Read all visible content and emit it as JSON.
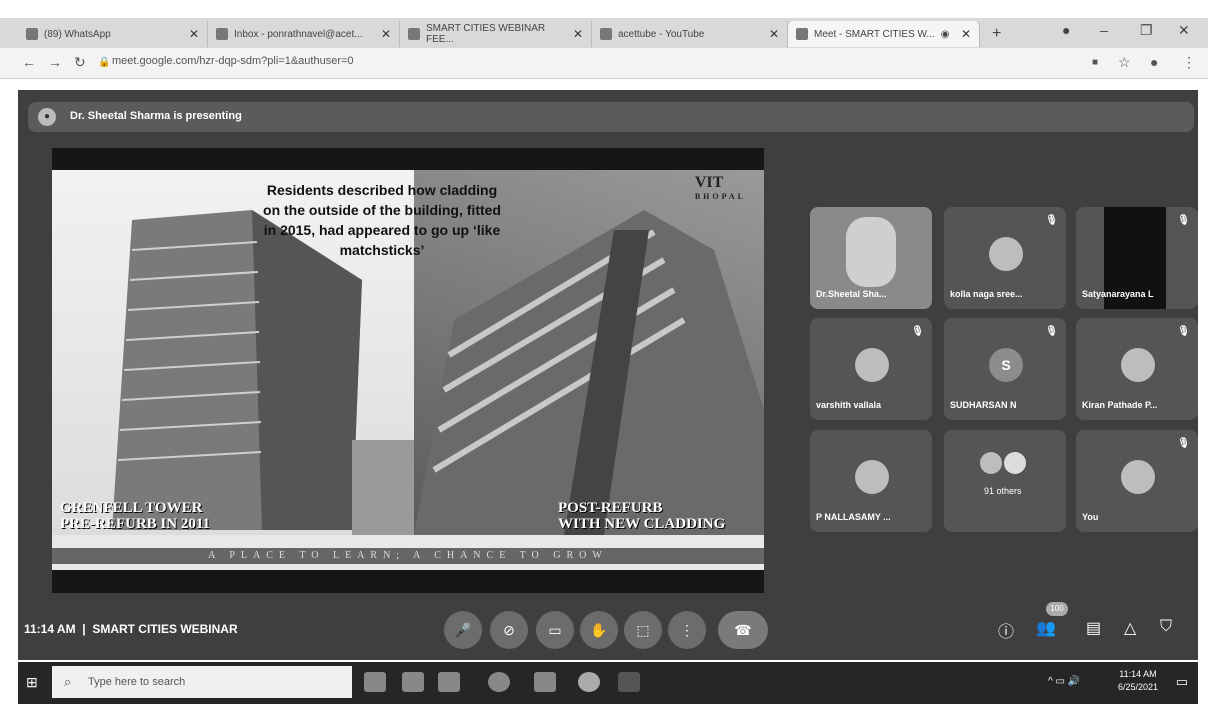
{
  "browser": {
    "tabs": [
      {
        "title": "(89) WhatsApp"
      },
      {
        "title": "Inbox - ponrathnavel@acet..."
      },
      {
        "title": "SMART CITIES WEBINAR FEE..."
      },
      {
        "title": "acettube - YouTube"
      },
      {
        "title": "Meet - SMART CITIES W..."
      }
    ],
    "url": "meet.google.com/hzr-dqp-sdm?pli=1&authuser=0"
  },
  "meet": {
    "presenting_text": "Dr. Sheetal Sharma is presenting",
    "slide": {
      "text": "Residents described how cladding on the outside of the building, fitted in 2015, had appeared to go up ‘like matchsticks’",
      "logo": "VIT",
      "logo_sub": "BHOPAL",
      "caption_left_1": "GRENFELL TOWER",
      "caption_left_2": "PRE-REFURB IN 2011",
      "caption_right_1": "POST-REFURB",
      "caption_right_2": "WITH NEW CLADDING",
      "tagline": "A PLACE TO LEARN; A CHANCE TO GROW"
    },
    "participants": [
      {
        "name": "Dr.Sheetal Sha..."
      },
      {
        "name": "kolla naga sree..."
      },
      {
        "name": "Satyanarayana L"
      },
      {
        "name": "varshith vallala"
      },
      {
        "name": "SUDHARSAN N",
        "initial": "S"
      },
      {
        "name": "Kiran Pathade P..."
      },
      {
        "name": "P NALLASAMY ..."
      },
      {
        "name": "91 others"
      },
      {
        "name": "You"
      }
    ],
    "meeting_time": "11:14 AM",
    "meeting_title": "SMART CITIES WEBINAR",
    "participant_count": "100"
  },
  "taskbar": {
    "search_placeholder": "Type here to search",
    "time": "11:14 AM",
    "date": "6/25/2021"
  }
}
